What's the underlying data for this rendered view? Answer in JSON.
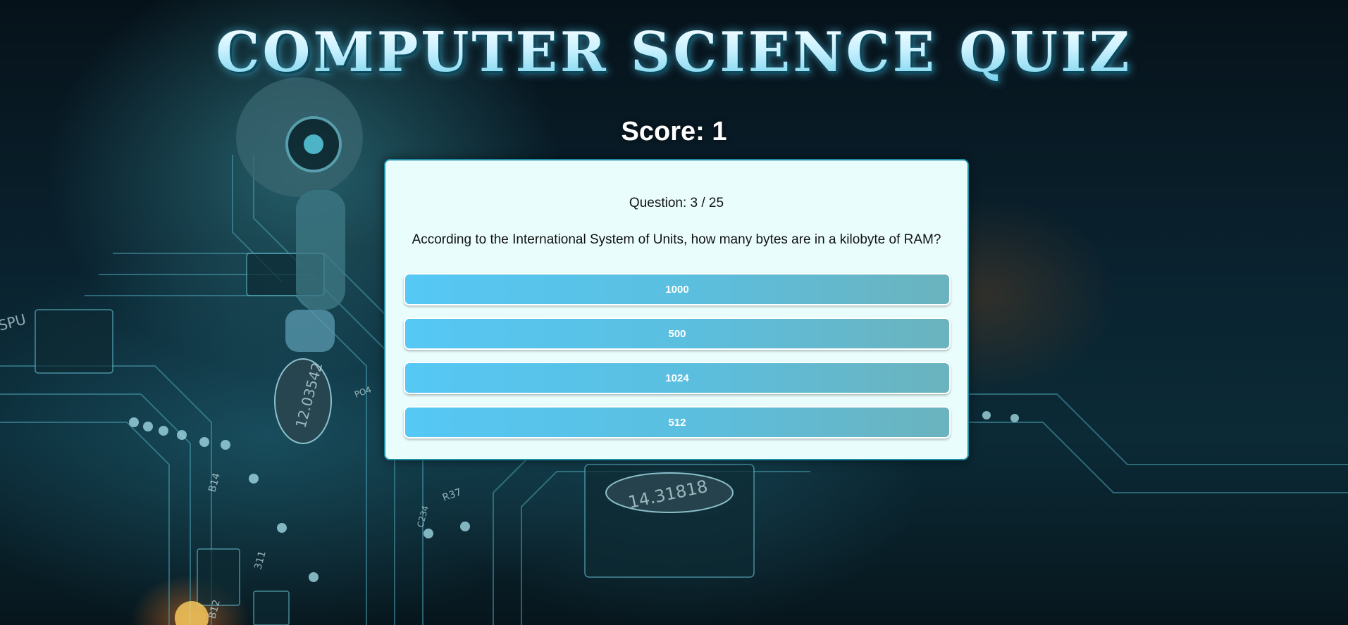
{
  "header": {
    "title": "COMPUTER SCIENCE QUIZ",
    "score_text": "Score: 1"
  },
  "quiz": {
    "counter_text": "Question: 3 / 25",
    "question": "According to the International System of Units, how many bytes are in a kilobyte of RAM?",
    "answers": [
      {
        "label": "1000"
      },
      {
        "label": "500"
      },
      {
        "label": "1024"
      },
      {
        "label": "512"
      }
    ]
  },
  "background": {
    "chip_labels": [
      "12.03542",
      "14.31818",
      "B14",
      "B12",
      "C234",
      "R37",
      "PO4",
      "311",
      "SPU"
    ]
  },
  "colors": {
    "card_background": "#eafdfd",
    "card_border": "#1e8ea6",
    "button_start": "#55c8f5",
    "button_end": "#6bb3be",
    "title_light": "#d9f6ff"
  }
}
